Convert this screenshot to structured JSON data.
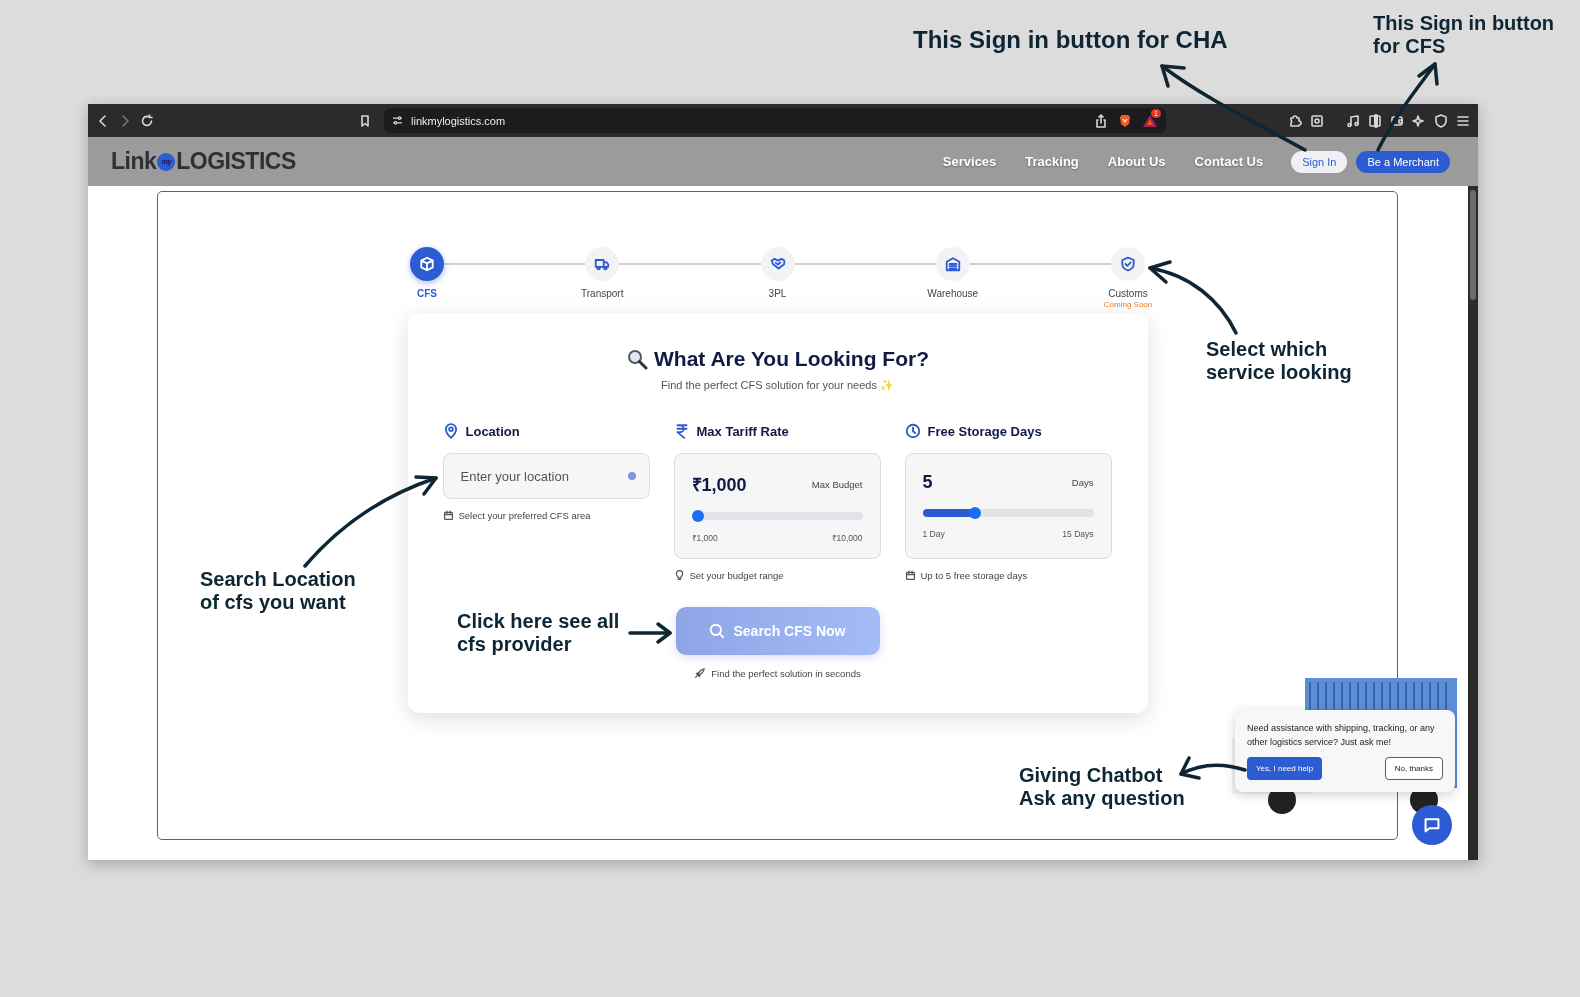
{
  "annotations": [
    {
      "text": "This Sign in button for CHA"
    },
    {
      "text": "This Sign in button for CFS"
    },
    {
      "text": "Select which service looking"
    },
    {
      "text": "Search Location of cfs you want"
    },
    {
      "text": "Click here see all cfs provider"
    },
    {
      "text": "Giving Chatbot Ask any question"
    }
  ],
  "browser": {
    "url": "linkmylogistics.com",
    "notification_count": "1"
  },
  "site": {
    "logo": {
      "part_1": "Link",
      "mark": "my",
      "part_2": "LOGISTICS"
    },
    "nav": [
      "Services",
      "Tracking",
      "About Us",
      "Contact Us"
    ],
    "sign_in": "Sign In",
    "merchant": "Be a Merchant"
  },
  "steps": [
    {
      "label": "CFS",
      "selected": true
    },
    {
      "label": "Transport",
      "selected": false
    },
    {
      "label": "3PL",
      "selected": false
    },
    {
      "label": "Warehouse",
      "selected": false
    },
    {
      "label": "Customs",
      "selected": false,
      "note": "Coming Soon"
    }
  ],
  "search": {
    "title": "What Are You Looking For?",
    "subtitle": "Find the perfect CFS solution for your needs ✨",
    "location": {
      "label": "Location",
      "placeholder": "Enter your location",
      "hint": "Select your preferred CFS area"
    },
    "sliders": [
      {
        "label": "Max Tariff Rate",
        "value": "₹1,000",
        "unit": "Max Budget",
        "level": 0,
        "min": "₹1,000",
        "max": "₹10,000",
        "hint": "Set your budget range"
      },
      {
        "label": "Free Storage Days",
        "value": "5",
        "unit": "Days",
        "level": 0.29,
        "min": "1 Day",
        "max": "15 Days",
        "hint": "Up to 5 free storage days"
      }
    ],
    "button": "Search CFS Now",
    "footnote": "Find the perfect solution in seconds"
  },
  "chat": {
    "message": "Need assistance with shipping, tracking, or any other logistics service? Just ask me!",
    "accept": "Yes, I need help",
    "decline": "No, thanks"
  }
}
